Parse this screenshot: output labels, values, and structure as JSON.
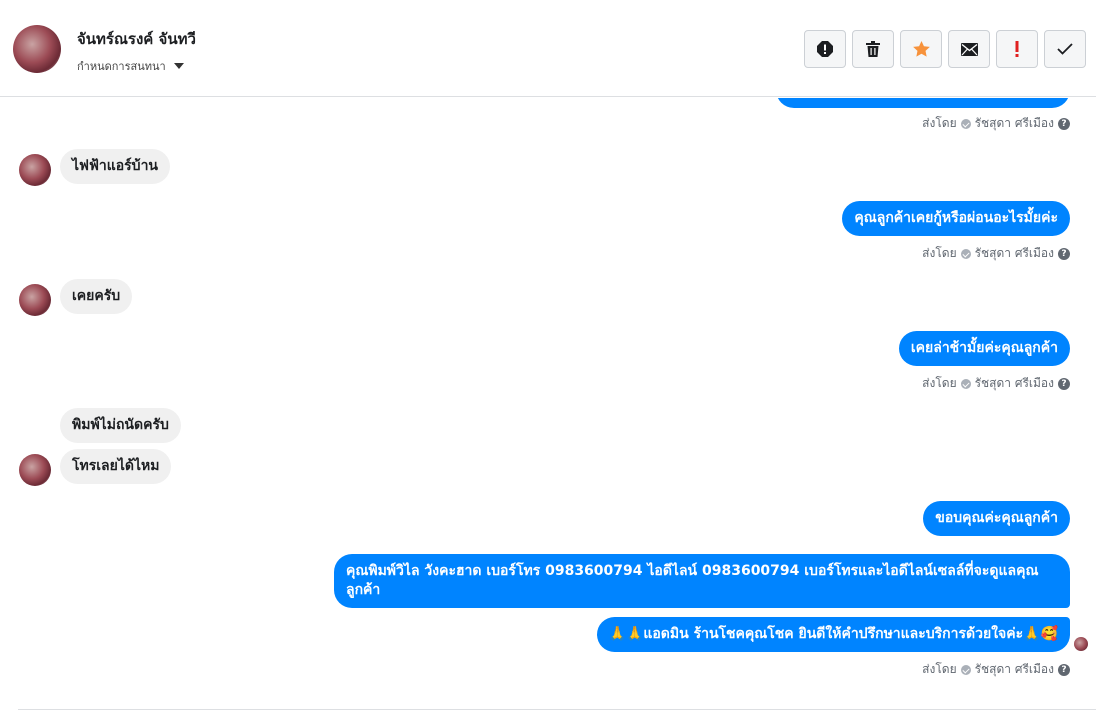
{
  "header": {
    "contact_name": "จันทร์ณรงค์ จันทวี",
    "assign_label": "กำหนดการสนทนา"
  },
  "toolbar": {
    "buttons": [
      {
        "name": "report-button",
        "icon": "alert-octagon-icon"
      },
      {
        "name": "delete-button",
        "icon": "trash-icon"
      },
      {
        "name": "star-button",
        "icon": "star-icon",
        "color": "#f7923b"
      },
      {
        "name": "mark-unread-button",
        "icon": "envelope-icon"
      },
      {
        "name": "follow-up-button",
        "icon": "exclamation-icon",
        "color": "#e02020"
      },
      {
        "name": "done-button",
        "icon": "check-icon"
      }
    ]
  },
  "sent_by": {
    "prefix": "ส่งโดย",
    "agent": "รัชสุดา ศรีเมือง"
  },
  "messages": [
    {
      "dir": "in",
      "text": "ไฟฟ้าแอร์บ้าน"
    },
    {
      "dir": "out",
      "text": "คุณลูกค้าเคยกู้หรือผ่อนอะไรมั้ยค่ะ"
    },
    {
      "dir": "in",
      "text": "เคยครับ"
    },
    {
      "dir": "out",
      "text": "เคยล่าช้ามั้ยค่ะคุณลูกค้า"
    },
    {
      "dir": "in",
      "text": "พิมพ์ไม่ถนัดครับ"
    },
    {
      "dir": "in",
      "text": "โทรเลยได้ไหม"
    },
    {
      "dir": "out",
      "text": "ขอบคุณค่ะคุณลูกค้า"
    },
    {
      "dir": "out",
      "text": "คุณพิมพ์วิไล วังคะฮาด   เบอร์โทร 0983600794  ไอดีไลน์ 0983600794   เบอร์โทรและไอดีไลน์เซลล์ที่จะดูแลคุณลูกค้า"
    },
    {
      "dir": "out",
      "text": "🙏🙏แอดมิน ร้านโชคคุณโชค ยินดีให้คำปรึกษาและบริการด้วยใจค่ะ🙏🥰"
    }
  ]
}
